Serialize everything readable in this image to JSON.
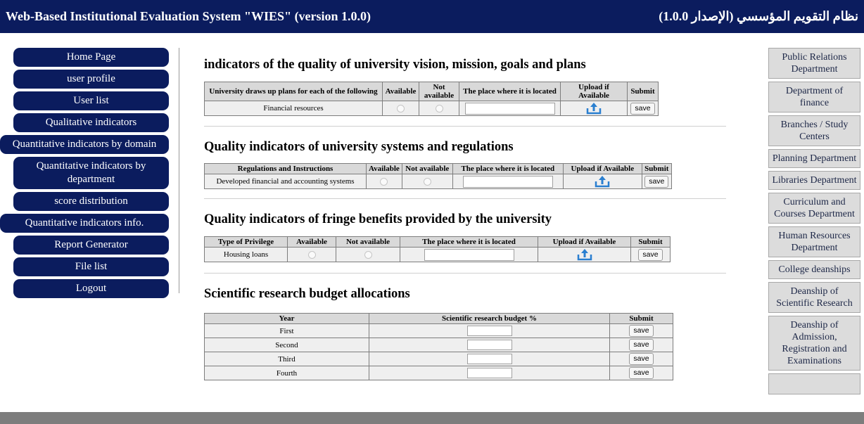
{
  "header": {
    "title_en": "Web-Based Institutional Evaluation System \"WIES\" (version 1.0.0)",
    "title_ar": "نظام التقويم المؤسسي (الإصدار 1.0.0)"
  },
  "left_nav": {
    "items": [
      "Home Page",
      "user profile",
      "User list",
      "Qualitative indicators",
      "Quantitative indicators by domain",
      "Quantitative indicators by department",
      "score distribution",
      "Quantitative indicators info.",
      "Report Generator",
      "File list",
      "Logout"
    ]
  },
  "sections": {
    "vision": {
      "title": "indicators of the quality of university vision, mission, goals and plans",
      "headers": [
        "University draws up plans for each of the following",
        "Available",
        "Not available",
        "The place where it is located",
        "Upload if Available",
        "Submit"
      ],
      "row_label": "Financial resources",
      "save": "save"
    },
    "systems": {
      "title": "Quality indicators of university systems and regulations",
      "headers": [
        "Regulations and Instructions",
        "Available",
        "Not available",
        "The place where it is located",
        "Upload if Available",
        "Submit"
      ],
      "row_label": "Developed financial and accounting systems",
      "save": "save"
    },
    "fringe": {
      "title": "Quality indicators of fringe benefits provided by the university",
      "headers": [
        "Type of Privilege",
        "Available",
        "Not available",
        "The place where it is located",
        "Upload if Available",
        "Submit"
      ],
      "row_label": "Housing loans",
      "save": "save"
    },
    "budget": {
      "title": "Scientific research budget allocations",
      "headers": [
        "Year",
        "Scientific research budget %",
        "Submit"
      ],
      "rows": [
        "First",
        "Second",
        "Third",
        "Fourth"
      ],
      "save": "save"
    }
  },
  "right_nav": {
    "items": [
      "Public Relations Department",
      "Department of finance",
      "Branches / Study Centers",
      "Planning Department",
      "Libraries Department",
      "Curriculum and Courses Department",
      "Human Resources Department",
      "College deanships",
      "Deanship of Scientific Research",
      "Deanship of Admission, Registration and Examinations",
      ""
    ]
  },
  "colors": {
    "header_bg": "#0b1c5e",
    "nav_bg": "#0b1c5e",
    "right_nav_bg": "#dcdcdc",
    "bottom_bar": "#7d7d7d"
  },
  "icons": {
    "upload": "upload-cloud-icon",
    "radio": "radio-button"
  }
}
